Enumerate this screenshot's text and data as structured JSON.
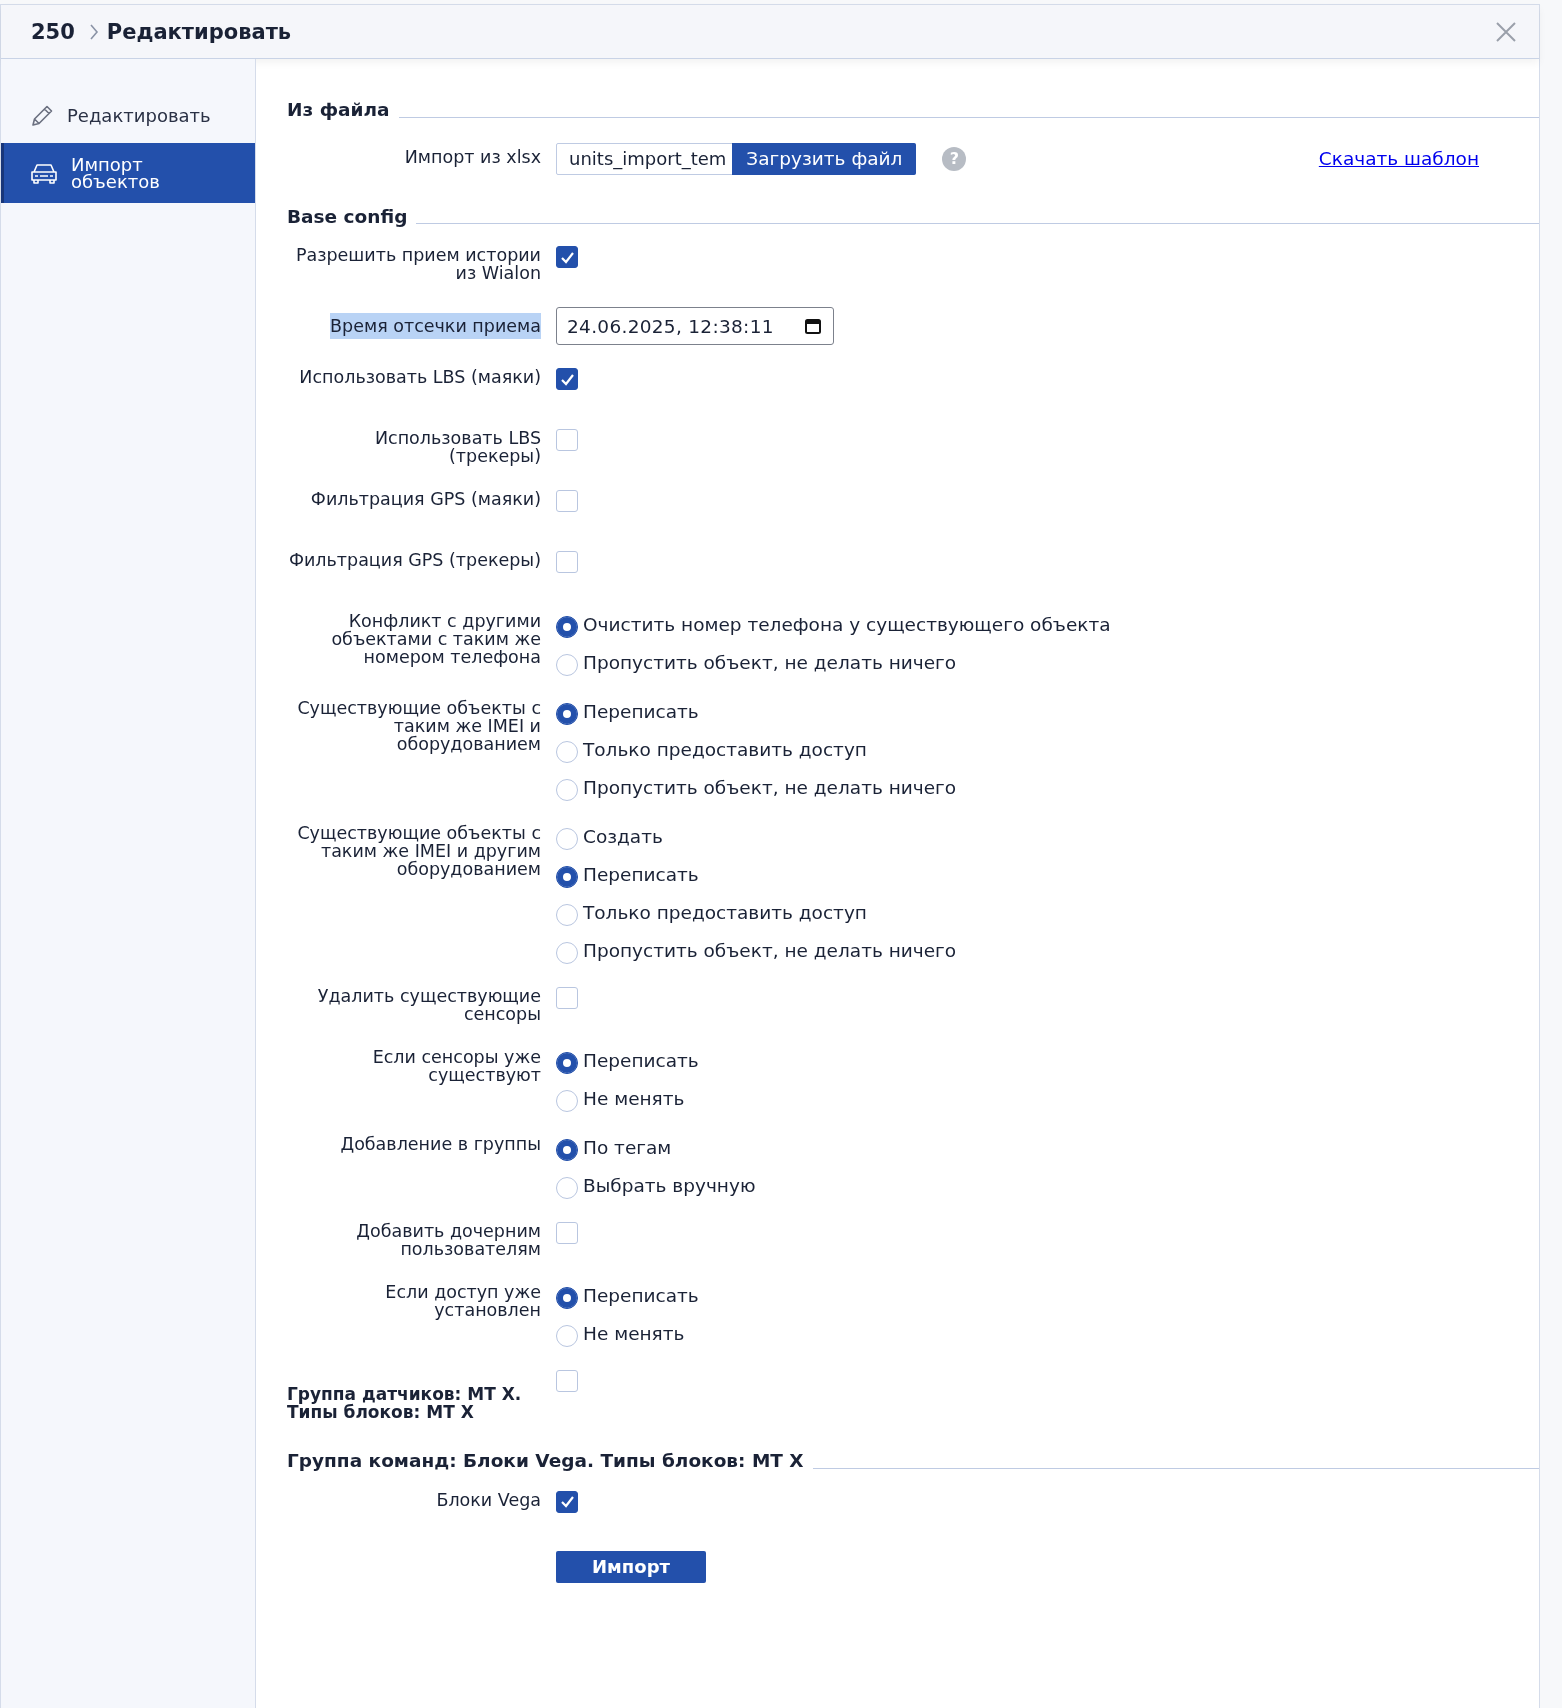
{
  "header": {
    "breadcrumb": "250",
    "title": "Редактировать"
  },
  "sidebar": {
    "items": [
      {
        "label": "Редактировать",
        "selected": false
      },
      {
        "label": "Импорт объектов",
        "selected": true
      }
    ]
  },
  "sections": [
    {
      "title": "Из файла",
      "rows": [
        {
          "kind": "file",
          "label": "Импорт из xlsx",
          "file_name": "units_import_tem",
          "button": "Загрузить файл",
          "help": "?",
          "link": "Скачать шаблон"
        }
      ]
    },
    {
      "title": "Base config",
      "rows": [
        {
          "kind": "checkbox",
          "label": "Разрешить прием истории из Wialon",
          "checked": true,
          "highlighted": false
        },
        {
          "kind": "datetime",
          "label": "Время отсечки приема",
          "value": "24.06.2025, 12:38:11",
          "highlighted": true
        },
        {
          "kind": "checkbox",
          "label": "Использовать LBS (маяки)",
          "checked": true,
          "highlighted": false
        },
        {
          "kind": "checkbox",
          "label": "Использовать LBS (трекеры)",
          "checked": false,
          "highlighted": false
        },
        {
          "kind": "checkbox",
          "label": "Фильтрация GPS (маяки)",
          "checked": false,
          "highlighted": false
        },
        {
          "kind": "checkbox",
          "label": "Фильтрация GPS (трекеры)",
          "checked": false,
          "highlighted": false
        },
        {
          "kind": "radio",
          "label": "Конфликт с другими объектами с таким же номером телефона",
          "highlighted": false,
          "options": [
            {
              "label": "Очистить номер телефона у существующего объекта",
              "selected": true
            },
            {
              "label": "Пропустить объект, не делать ничего",
              "selected": false
            }
          ]
        },
        {
          "kind": "radio",
          "label": "Существующие объекты с таким же IMEI и оборудованием",
          "highlighted": false,
          "options": [
            {
              "label": "Переписать",
              "selected": true
            },
            {
              "label": "Только предоставить доступ",
              "selected": false
            },
            {
              "label": "Пропустить объект, не делать ничего",
              "selected": false
            }
          ]
        },
        {
          "kind": "radio",
          "label": "Существующие объекты с таким же IMEI и другим оборудованием",
          "highlighted": false,
          "options": [
            {
              "label": "Создать",
              "selected": false
            },
            {
              "label": "Переписать",
              "selected": true
            },
            {
              "label": "Только предоставить доступ",
              "selected": false
            },
            {
              "label": "Пропустить объект, не делать ничего",
              "selected": false
            }
          ]
        },
        {
          "kind": "checkbox",
          "label": "Удалить существующие сенсоры",
          "checked": false,
          "highlighted": false
        },
        {
          "kind": "radio",
          "label": "Если сенсоры уже существуют",
          "highlighted": false,
          "options": [
            {
              "label": "Переписать",
              "selected": true
            },
            {
              "label": "Не менять",
              "selected": false
            }
          ]
        },
        {
          "kind": "radio",
          "label": "Добавление в группы",
          "highlighted": false,
          "options": [
            {
              "label": "По тегам",
              "selected": true
            },
            {
              "label": "Выбрать вручную",
              "selected": false
            }
          ]
        },
        {
          "kind": "checkbox",
          "label": "Добавить дочерним пользователям",
          "checked": false,
          "highlighted": false
        },
        {
          "kind": "radio",
          "label": "Если доступ уже установлен",
          "highlighted": false,
          "options": [
            {
              "label": "Переписать",
              "selected": true
            },
            {
              "label": "Не менять",
              "selected": false
            }
          ]
        },
        {
          "kind": "group_checkbox",
          "label": "Группа датчиков: MT X. Типы блоков: MT X",
          "checked": false,
          "highlighted": false
        }
      ]
    },
    {
      "title": "Группа команд: Блоки Vega. Типы блоков: MT X",
      "rows": [
        {
          "kind": "checkbox",
          "label": "Блоки Vega",
          "checked": true,
          "highlighted": false
        }
      ]
    }
  ],
  "submit": "Импорт"
}
